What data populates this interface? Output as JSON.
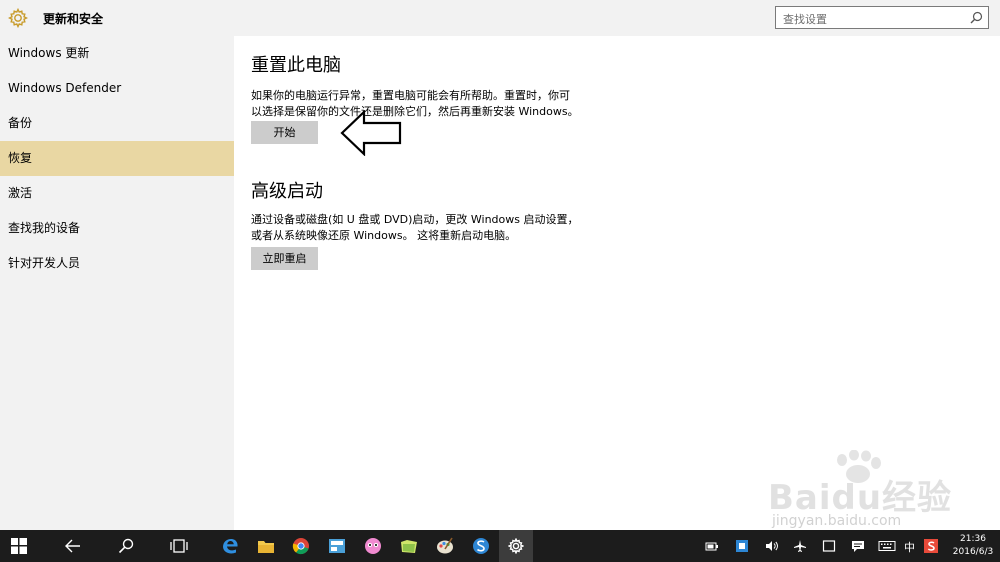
{
  "header": {
    "title": "更新和安全",
    "search_placeholder": "查找设置"
  },
  "sidebar": {
    "items": [
      {
        "label": "Windows 更新"
      },
      {
        "label": "Windows Defender"
      },
      {
        "label": "备份"
      },
      {
        "label": "恢复",
        "selected": true
      },
      {
        "label": "激活"
      },
      {
        "label": "查找我的设备"
      },
      {
        "label": "针对开发人员"
      }
    ]
  },
  "main": {
    "reset": {
      "title": "重置此电脑",
      "desc_line1": "如果你的电脑运行异常，重置电脑可能会有所帮助。重置时，你可",
      "desc_line2": "以选择是保留你的文件还是删除它们，然后再重新安装 Windows。",
      "button": "开始"
    },
    "advanced": {
      "title": "高级启动",
      "desc_line1": "通过设备或磁盘(如 U 盘或 DVD)启动，更改 Windows 启动设置，",
      "desc_line2": "或者从系统映像还原 Windows。 这将重新启动电脑。",
      "button": "立即重启"
    }
  },
  "watermark": {
    "brand": "Baidu经验",
    "url": "jingyan.baidu.com"
  },
  "taskbar": {
    "ime": "中",
    "time": "21:36",
    "date": "2016/6/3"
  },
  "colors": {
    "selected_nav": "#e9d7a3",
    "sidebar_bg": "#f2f2f2",
    "taskbar_bg": "#1c1c1c",
    "button_bg": "#cccccc"
  },
  "icons": [
    "gear-icon",
    "search-icon",
    "arrow-left-annotation",
    "windows-start-icon",
    "back-icon",
    "cortana-search-icon",
    "task-view-icon",
    "edge-icon",
    "file-explorer-icon",
    "chrome-icon",
    "app-icon",
    "qq-pet-icon",
    "folder-icon",
    "paint-icon",
    "sogou-icon",
    "settings-icon"
  ]
}
